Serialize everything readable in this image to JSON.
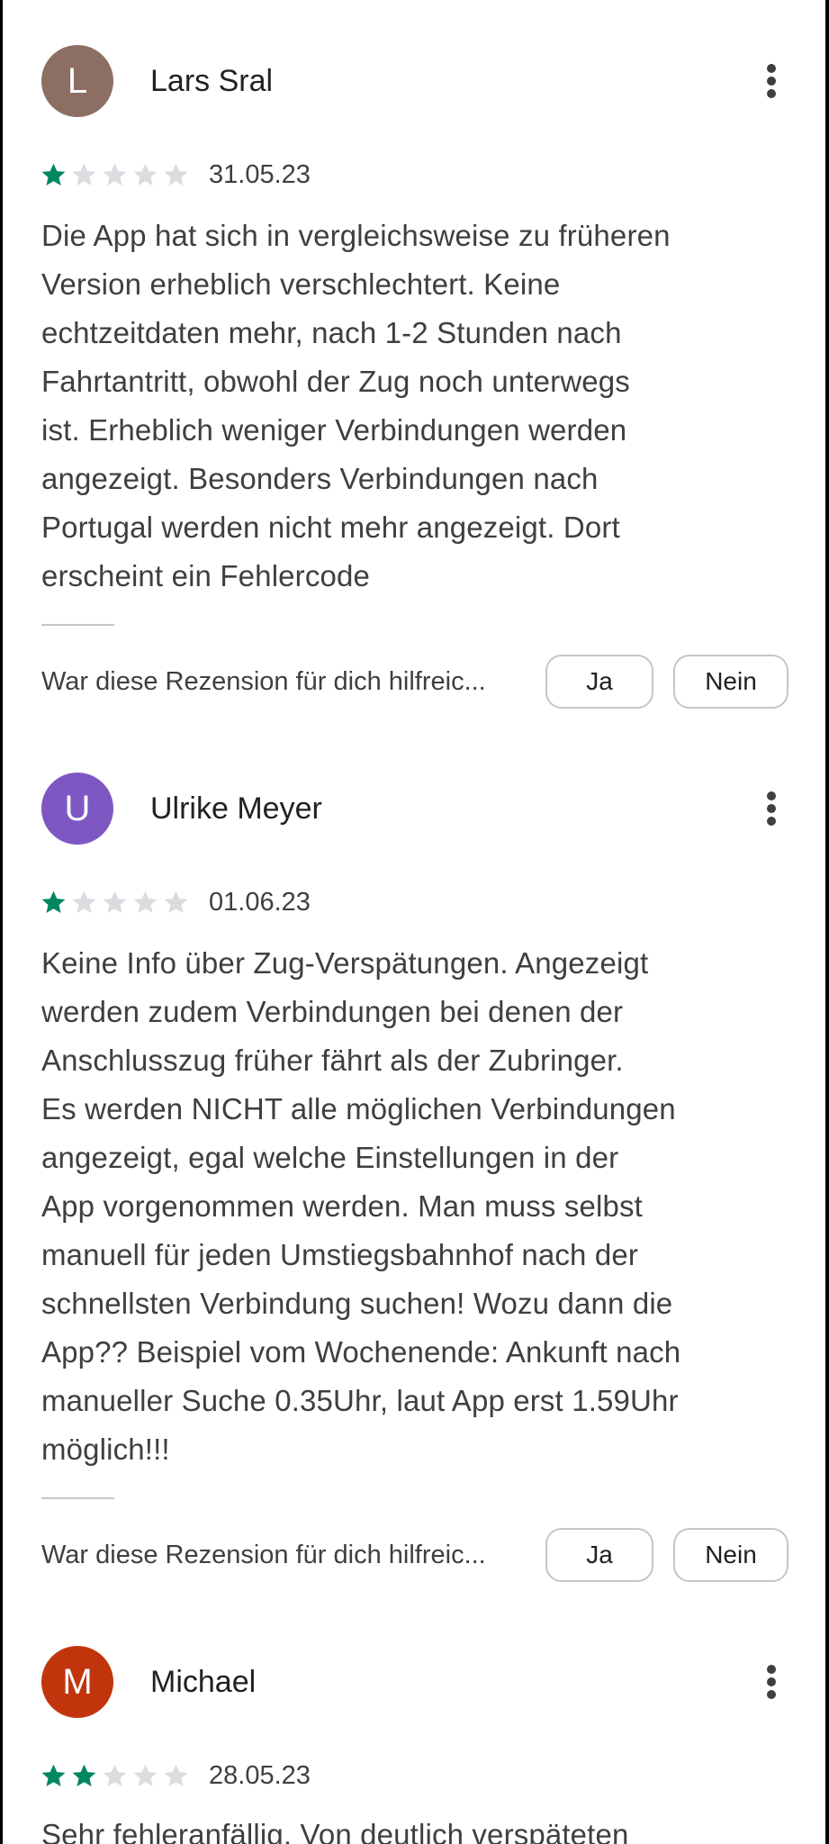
{
  "colors": {
    "star_filled": "#01875f",
    "star_empty": "#dadce0",
    "accent_text": "#3c4043"
  },
  "icons": {
    "star": "star-icon",
    "more": "more-vert-icon"
  },
  "reviews": [
    {
      "initial": "L",
      "avatar_color": "#8d6e63",
      "author": "Lars Sral",
      "rating": 1,
      "date": "31.05.23",
      "text": "Die App hat sich in vergleichsweise zu früheren\nVersion erheblich verschlechtert. Keine\nechtzeitdaten mehr, nach 1-2 Stunden nach\nFahrtantritt, obwohl der Zug noch unterwegs\nist. Erheblich weniger Verbindungen werden\nangezeigt. Besonders Verbindungen nach\nPortugal werden nicht mehr angezeigt. Dort\nerscheint ein Fehlercode",
      "helpful_question": "War diese Rezension für dich hilfreic...",
      "yes_label": "Ja",
      "no_label": "Nein"
    },
    {
      "initial": "U",
      "avatar_color": "#7e57c2",
      "author": "Ulrike Meyer",
      "rating": 1,
      "date": "01.06.23",
      "text": "Keine Info über Zug-Verspätungen. Angezeigt\nwerden zudem Verbindungen bei denen der\nAnschlusszug früher fährt als der Zubringer.\nEs werden NICHT alle möglichen Verbindungen\nangezeigt, egal welche Einstellungen in der\nApp vorgenommen werden. Man muss selbst\nmanuell für jeden Umstiegsbahnhof nach der\nschnellsten Verbindung suchen! Wozu dann die\nApp?? Beispiel vom Wochenende: Ankunft nach\nmanueller Suche 0.35Uhr, laut App erst 1.59Uhr\nmöglich!!!",
      "helpful_question": "War diese Rezension für dich hilfreic...",
      "yes_label": "Ja",
      "no_label": "Nein"
    },
    {
      "initial": "M",
      "avatar_color": "#c1350d",
      "author": "Michael",
      "rating": 2,
      "date": "28.05.23",
      "text": "Sehr fehleranfällig. Von deutlich verspäteten"
    }
  ]
}
